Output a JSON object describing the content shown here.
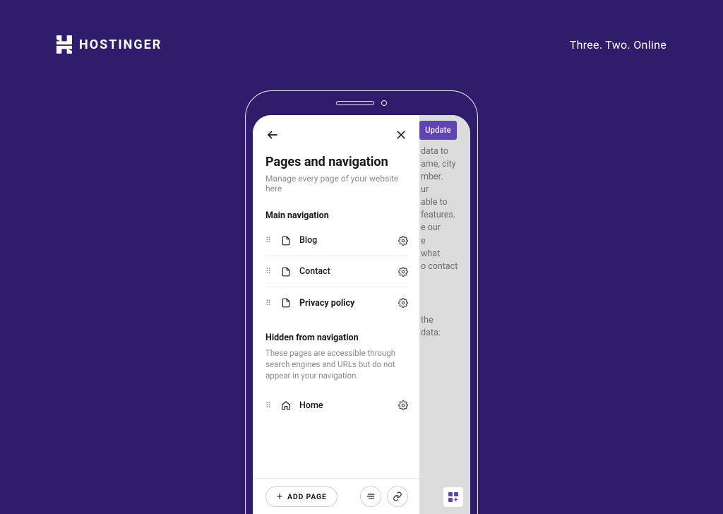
{
  "brand": {
    "name": "HOSTINGER",
    "tagline": "Three. Two. Online"
  },
  "panel": {
    "title": "Pages and navigation",
    "subtitle": "Manage every page of your website here",
    "main_nav": {
      "heading": "Main navigation",
      "items": [
        {
          "label": "Blog",
          "bold": false
        },
        {
          "label": "Contact",
          "bold": false
        },
        {
          "label": "Privacy policy",
          "bold": true
        }
      ]
    },
    "hidden": {
      "heading": "Hidden from navigation",
      "description": "These pages are accessible through search engines and URLs but do not appear in your navigation.",
      "items": [
        {
          "label": "Home",
          "icon": "home"
        }
      ]
    },
    "add_label": "ADD PAGE"
  },
  "bg": {
    "update_label": "Update",
    "body1": "data to\name, city\nmber.\nur\nable to\n features.\ne our\ne\nwhat\no contact",
    "body2": " the\ndata:"
  }
}
